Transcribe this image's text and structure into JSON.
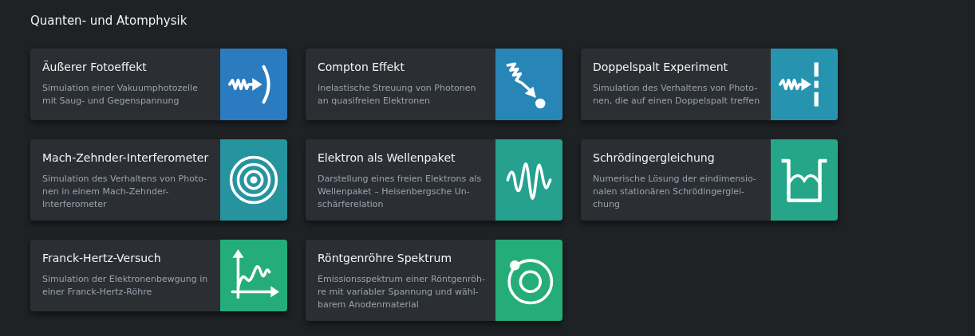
{
  "section": {
    "title": "Quanten- und Atomphysik"
  },
  "cards": [
    {
      "title": "Äußerer Fotoeffekt",
      "description_lines": [
        "Simulation einer Vakuumphotozelle",
        "mit Saug- und Gegenspannung"
      ],
      "kind": "photoeffect",
      "color": "#2b7bc0"
    },
    {
      "title": "Compton Effekt",
      "description_lines": [
        "Inelastische Streuung von Photonen",
        "an quasifreien Elektronen"
      ],
      "kind": "compton",
      "color": "#2886b7"
    },
    {
      "title": "Doppelspalt Experiment",
      "description_lines": [
        "Simulation des Verhaltens von Photo-",
        "nen, die auf einen Doppelspalt treffen"
      ],
      "kind": "doubleslit",
      "color": "#2694ae"
    },
    {
      "title": "Mach-Zehnder-Interferometer",
      "description_lines": [
        "Simulation des Verhaltens von Photo-",
        "nen in einem Mach-Zehnder-",
        "Interferometer"
      ],
      "kind": "rings",
      "color": "#25949f"
    },
    {
      "title": "Elektron als Wellenpaket",
      "description_lines": [
        "Darstellung eines freien Elektrons als",
        "Wellenpaket – Heisenbergsche Un-",
        "schärferelation"
      ],
      "kind": "wavepacket",
      "color": "#26a08f"
    },
    {
      "title": "Schrödingergleichung",
      "description_lines": [
        "Numerische Lösung der eindimensio-",
        "nalen stationären Schrödingerglei-",
        "chung"
      ],
      "kind": "well",
      "color": "#25a689"
    },
    {
      "title": "Franck-Hertz-Versuch",
      "description_lines": [
        "Simulation der Elektronenbewgung in",
        "einer Franck-Hertz-Röhre"
      ],
      "kind": "graph",
      "color": "#24ad7b"
    },
    {
      "title": "Röntgenröhre Spektrum",
      "description_lines": [
        "Emissionsspektrum einer Röntgenröh-",
        "re mit variabler Spannung und wähl-",
        "barem Anodenmaterial"
      ],
      "kind": "orbit",
      "color": "#25ad77"
    }
  ]
}
